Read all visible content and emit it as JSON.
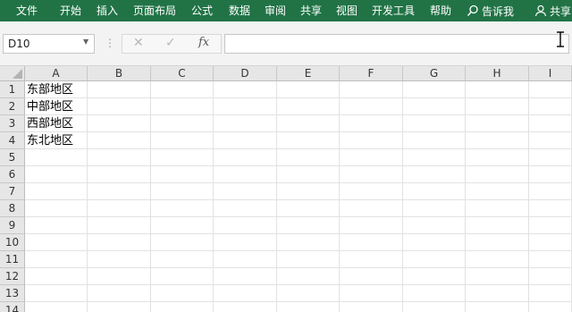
{
  "ribbon": {
    "tabs": [
      "文件",
      "开始",
      "插入",
      "页面布局",
      "公式",
      "数据",
      "审阅",
      "共享",
      "视图",
      "开发工具",
      "帮助"
    ],
    "search_label": "告诉我",
    "share_label": "共享"
  },
  "formula_bar": {
    "name_box": "D10",
    "cancel_glyph": "✕",
    "enter_glyph": "✓",
    "fx_label": "fx",
    "formula_value": ""
  },
  "sheet": {
    "columns": [
      "A",
      "B",
      "C",
      "D",
      "E",
      "F",
      "G",
      "H",
      "I"
    ],
    "rows": [
      "1",
      "2",
      "3",
      "4",
      "5",
      "6",
      "7",
      "8",
      "9",
      "10",
      "11",
      "12",
      "13",
      "14"
    ],
    "column_a_values": [
      "东部地区",
      "中部地区",
      "西部地区",
      "东北地区"
    ]
  },
  "colors": {
    "ribbon": "#217346",
    "header_bg": "#e6e6e6",
    "gridline": "#e2e2e2"
  }
}
